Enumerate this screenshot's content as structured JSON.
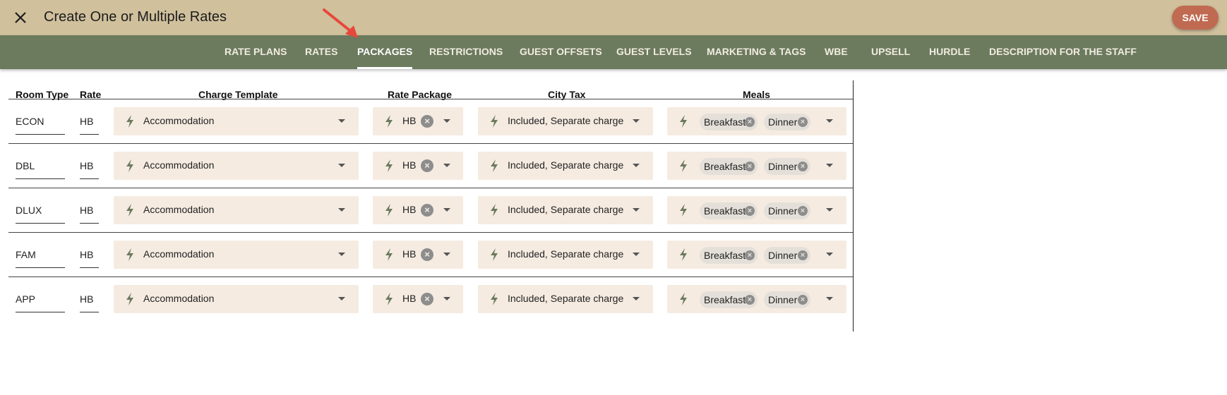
{
  "header": {
    "title": "Create One or Multiple Rates",
    "save_label": "SAVE",
    "close_icon": "close-icon"
  },
  "tabs": [
    {
      "label": "RATE PLANS",
      "active": false
    },
    {
      "label": "RATES",
      "active": false
    },
    {
      "label": "PACKAGES",
      "active": true
    },
    {
      "label": "RESTRICTIONS",
      "active": false
    },
    {
      "label": "GUEST OFFSETS",
      "active": false
    },
    {
      "label": "GUEST LEVELS",
      "active": false
    },
    {
      "label": "MARKETING & TAGS",
      "active": false
    },
    {
      "label": "WBE",
      "active": false
    },
    {
      "label": "UPSELL",
      "active": false
    },
    {
      "label": "HURDLE",
      "active": false
    },
    {
      "label": "DESCRIPTION FOR THE STAFF",
      "active": false
    }
  ],
  "table": {
    "headers": {
      "room_type": "Room Type",
      "rate": "Rate",
      "charge_template": "Charge Template",
      "rate_package": "Rate Package",
      "city_tax": "City Tax",
      "meals": "Meals"
    },
    "rows": [
      {
        "room_type": "ECON",
        "rate": "HB",
        "charge_template": "Accommodation",
        "rate_package": "HB",
        "city_tax": "Included, Separate charge",
        "meals": [
          "Breakfast",
          "Dinner"
        ]
      },
      {
        "room_type": "DBL",
        "rate": "HB",
        "charge_template": "Accommodation",
        "rate_package": "HB",
        "city_tax": "Included, Separate charge",
        "meals": [
          "Breakfast",
          "Dinner"
        ]
      },
      {
        "room_type": "DLUX",
        "rate": "HB",
        "charge_template": "Accommodation",
        "rate_package": "HB",
        "city_tax": "Included, Separate charge",
        "meals": [
          "Breakfast",
          "Dinner"
        ]
      },
      {
        "room_type": "FAM",
        "rate": "HB",
        "charge_template": "Accommodation",
        "rate_package": "HB",
        "city_tax": "Included, Separate charge",
        "meals": [
          "Breakfast",
          "Dinner"
        ]
      },
      {
        "room_type": "APP",
        "rate": "HB",
        "charge_template": "Accommodation",
        "rate_package": "HB",
        "city_tax": "Included, Separate charge",
        "meals": [
          "Breakfast",
          "Dinner"
        ]
      }
    ]
  },
  "colors": {
    "topbar": "#d0c09c",
    "tabbar": "#6c7a5e",
    "save": "#c06a52",
    "field_bg": "#f5ebe1",
    "bolt": "#6c7a5e",
    "arrow": "#e8473c"
  },
  "icons": {
    "bolt": "lightning-bolt-icon",
    "clear": "clear-circle-icon",
    "dropdown": "caret-down-icon",
    "annotation": "red-arrow-icon"
  }
}
